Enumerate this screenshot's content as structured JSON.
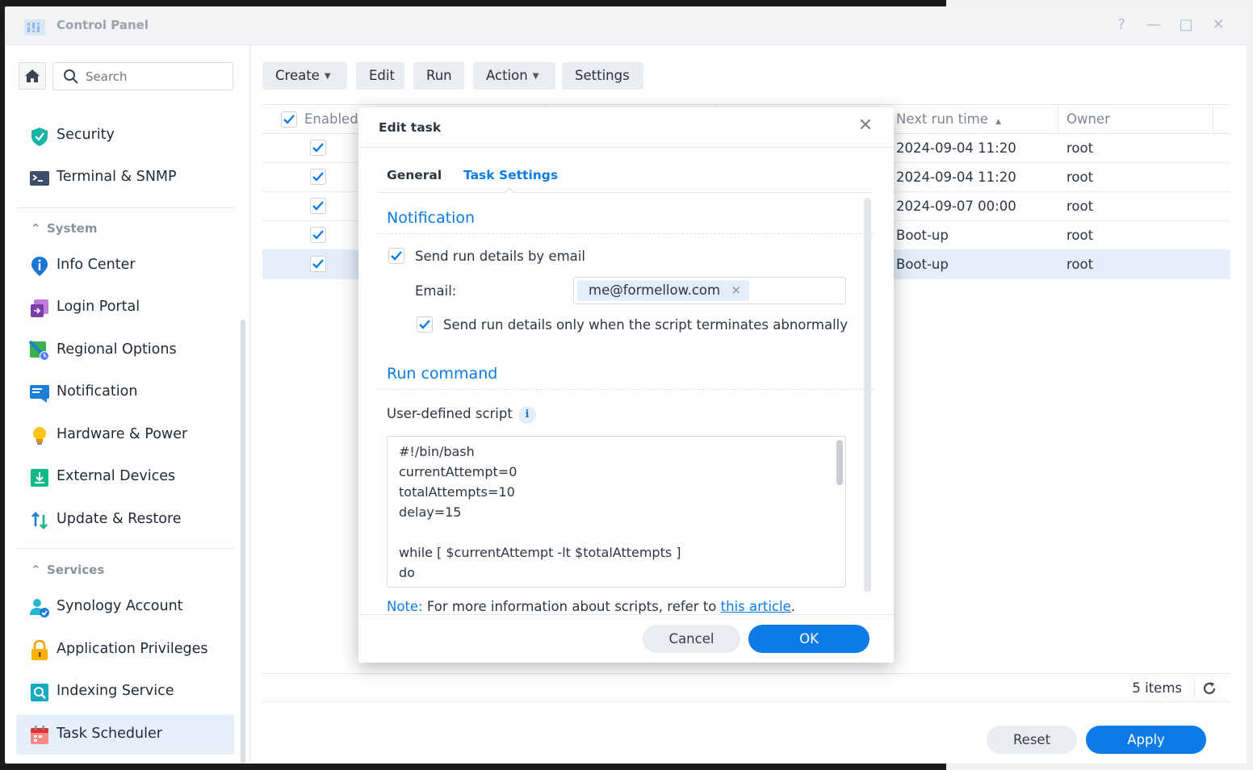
{
  "window": {
    "title": "Control Panel",
    "controls": {
      "help": "?",
      "minimize": "—",
      "maximize": "□",
      "close": "✕"
    }
  },
  "sidebar": {
    "search": {
      "placeholder": "Search",
      "value": ""
    },
    "items_top": [
      {
        "label": "Security",
        "icon": "shield-icon"
      },
      {
        "label": "Terminal & SNMP",
        "icon": "terminal-icon"
      }
    ],
    "group_system": "System",
    "items_system": [
      {
        "label": "Info Center",
        "icon": "info-icon"
      },
      {
        "label": "Login Portal",
        "icon": "login-portal-icon"
      },
      {
        "label": "Regional Options",
        "icon": "regional-options-icon"
      },
      {
        "label": "Notification",
        "icon": "notification-icon"
      },
      {
        "label": "Hardware & Power",
        "icon": "lightbulb-icon"
      },
      {
        "label": "External Devices",
        "icon": "external-devices-icon"
      },
      {
        "label": "Update & Restore",
        "icon": "update-restore-icon"
      }
    ],
    "group_services": "Services",
    "items_services": [
      {
        "label": "Synology Account",
        "icon": "account-icon"
      },
      {
        "label": "Application Privileges",
        "icon": "lock-icon"
      },
      {
        "label": "Indexing Service",
        "icon": "indexing-icon"
      },
      {
        "label": "Task Scheduler",
        "icon": "calendar-icon",
        "active": true
      }
    ]
  },
  "toolbar": {
    "create": "Create",
    "edit": "Edit",
    "run": "Run",
    "action": "Action",
    "settings": "Settings"
  },
  "table": {
    "columns": {
      "enabled": "Enabled",
      "next_run": "Next run time",
      "owner": "Owner"
    },
    "rows": [
      {
        "enabled": true,
        "next_run": "2024-09-04 11:20",
        "owner": "root",
        "selected": false
      },
      {
        "enabled": true,
        "next_run": "2024-09-04 11:20",
        "owner": "root",
        "selected": false
      },
      {
        "enabled": true,
        "next_run": "2024-09-07 00:00",
        "owner": "root",
        "selected": false
      },
      {
        "enabled": true,
        "next_run": "Boot-up",
        "owner": "root",
        "selected": false
      },
      {
        "enabled": true,
        "next_run": "Boot-up",
        "owner": "root",
        "selected": true
      }
    ],
    "footer": {
      "count": "5 items"
    }
  },
  "page_buttons": {
    "reset": "Reset",
    "apply": "Apply"
  },
  "dialog": {
    "title": "Edit task",
    "tabs": {
      "general": "General",
      "task_settings": "Task Settings",
      "active": "task_settings"
    },
    "notification": {
      "heading": "Notification",
      "send_email_label": "Send run details by email",
      "send_email_checked": true,
      "email_label": "Email:",
      "email_value": "me@formellow.com",
      "abnormal_only_label": "Send run details only when the script terminates abnormally",
      "abnormal_only_checked": true
    },
    "run_command": {
      "heading": "Run command",
      "script_label": "User-defined script",
      "script": "#!/bin/bash\ncurrentAttempt=0\ntotalAttempts=10\ndelay=15\n\nwhile [ $currentAttempt -lt $totalAttempts ]\ndo"
    },
    "note": {
      "lead": "Note:",
      "text": " For more information about scripts, refer to ",
      "link": "this article",
      "tail": "."
    },
    "buttons": {
      "cancel": "Cancel",
      "ok": "OK"
    }
  },
  "colors": {
    "accent": "#0c7be8",
    "selected_row": "#e3eefa",
    "active_nav": "#e6f0fb"
  }
}
